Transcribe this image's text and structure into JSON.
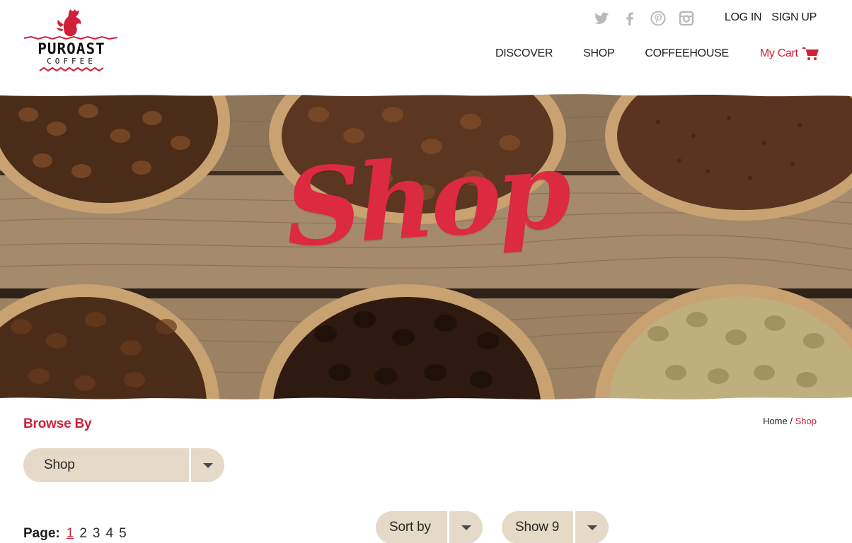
{
  "brand": {
    "name": "PUROAST",
    "subtitle": "COFFEE",
    "accent_color": "#d0203a"
  },
  "social": [
    {
      "icon": "twitter-icon"
    },
    {
      "icon": "facebook-icon"
    },
    {
      "icon": "pinterest-icon"
    },
    {
      "icon": "instagram-icon"
    }
  ],
  "auth": {
    "login": "LOG IN",
    "signup": "SIGN UP"
  },
  "nav": {
    "discover": "DISCOVER",
    "shop": "SHOP",
    "coffeehouse": "COFFEEHOUSE",
    "cart": "My Cart",
    "cart_icon": "cart-icon"
  },
  "hero": {
    "title": "Shop"
  },
  "browse": {
    "title": "Browse By",
    "selected": "Shop"
  },
  "breadcrumb": {
    "home": "Home",
    "separator": "/",
    "current": "Shop"
  },
  "pagination": {
    "label": "Page:",
    "pages": [
      "1",
      "2",
      "3",
      "4",
      "5"
    ],
    "current": "1"
  },
  "sort": {
    "label": "Sort by"
  },
  "show": {
    "label": "Show 9"
  }
}
